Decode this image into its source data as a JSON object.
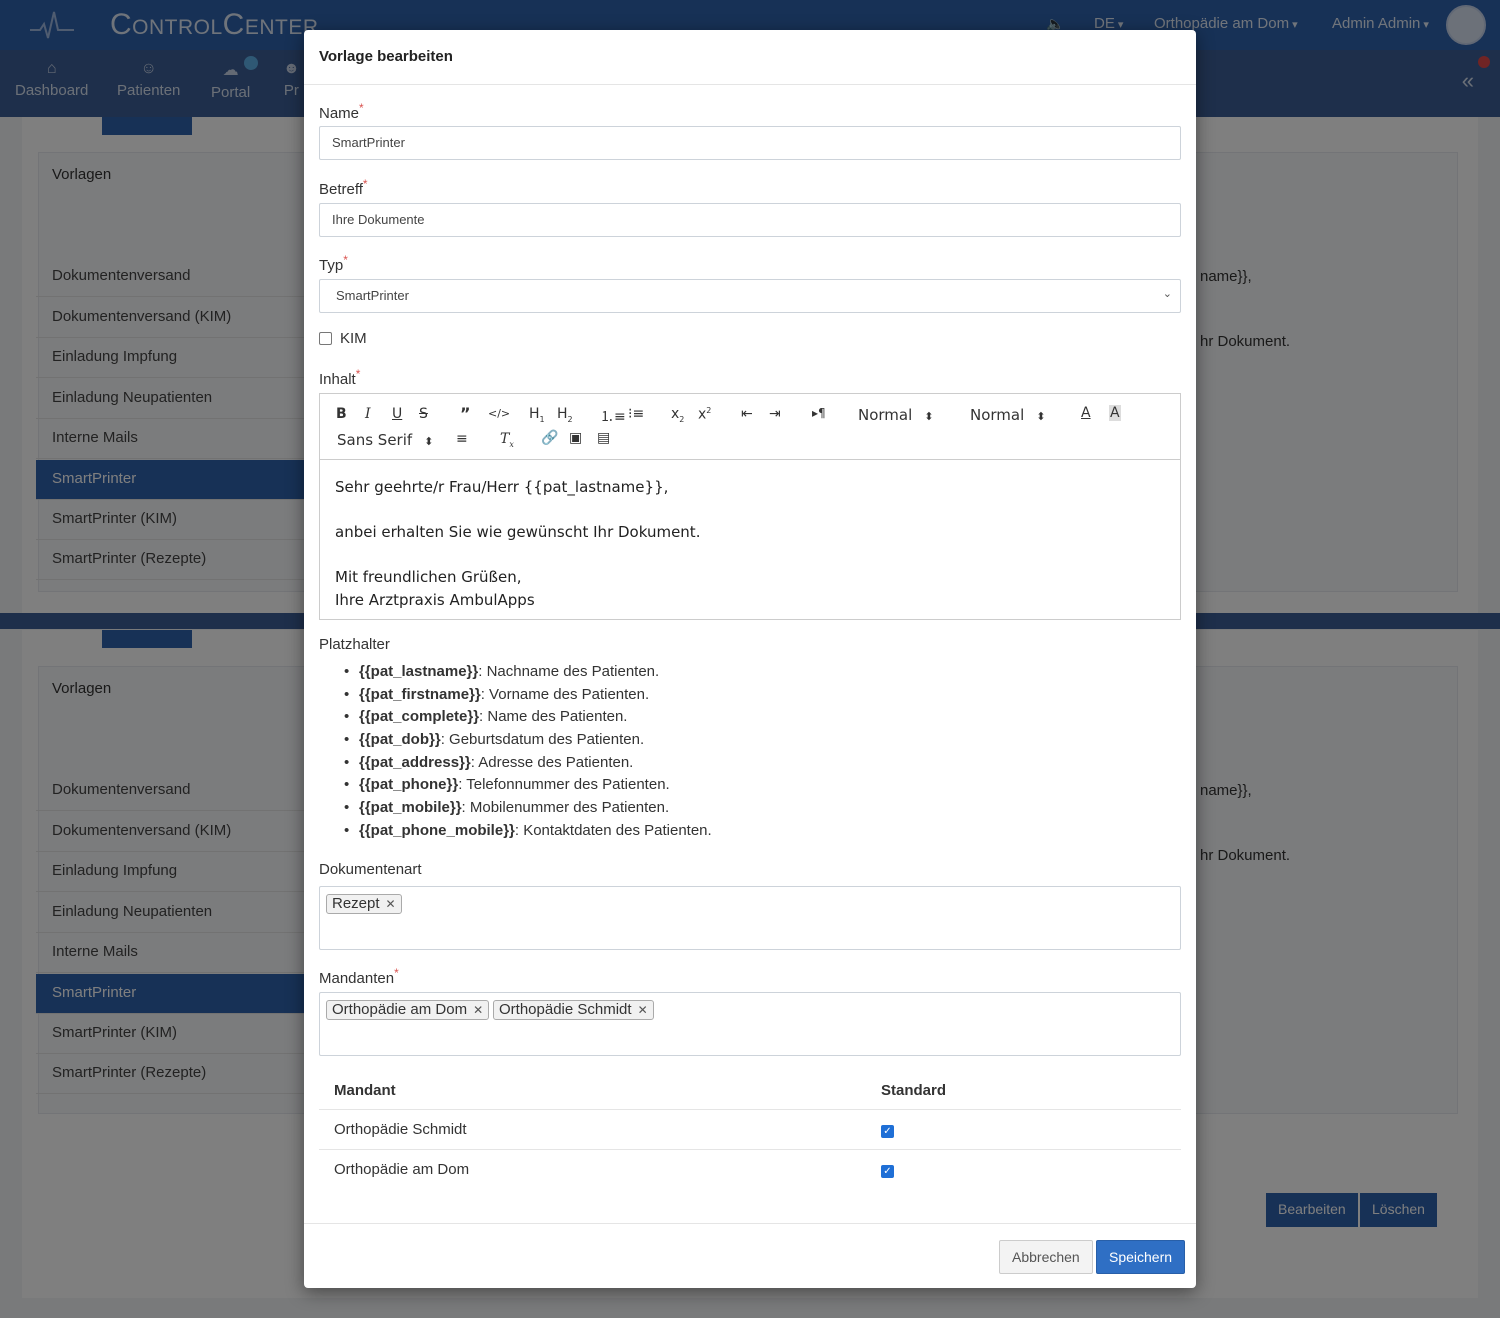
{
  "app": {
    "brand": "ControlCenter",
    "language": "DE",
    "practice": "Orthopädie am Dom",
    "user": "Admin Admin",
    "nav": [
      "Dashboard",
      "Patienten",
      "Portal",
      "Pr"
    ],
    "bg_card_title": "Vorlagen",
    "templates": [
      "Dokumentenversand",
      "Dokumentenversand (KIM)",
      "Einladung Impfung",
      "Einladung Neupatienten",
      "Interne Mails",
      "SmartPrinter",
      "SmartPrinter (KIM)",
      "SmartPrinter (Rezepte)"
    ],
    "bg_preview_1": "name}},",
    "bg_preview_2": "hr Dokument.",
    "btn_edit": "Bearbeiten",
    "btn_delete": "Löschen"
  },
  "modal": {
    "title": "Vorlage bearbeiten",
    "name_label": "Name",
    "name_value": "SmartPrinter",
    "subject_label": "Betreff",
    "subject_value": "Ihre Dokumente",
    "type_label": "Typ",
    "type_value": "SmartPrinter",
    "kim_label": "KIM",
    "content_label": "Inhalt",
    "toolbar": {
      "header_dropdown": "Normal",
      "size_dropdown": "Normal",
      "font_dropdown": "Sans Serif"
    },
    "content_lines": [
      "Sehr geehrte/r Frau/Herr {{pat_lastname}},",
      "",
      "anbei erhalten Sie wie gewünscht Ihr Dokument.",
      "",
      "Mit freundlichen Grüßen,",
      "Ihre Arztpraxis AmbulApps"
    ],
    "placeholders_title": "Platzhalter",
    "placeholders": [
      {
        "key": "{{pat_lastname}}",
        "desc": ": Nachname des Patienten."
      },
      {
        "key": "{{pat_firstname}}",
        "desc": ": Vorname des Patienten."
      },
      {
        "key": "{{pat_complete}}",
        "desc": ": Name des Patienten."
      },
      {
        "key": "{{pat_dob}}",
        "desc": ": Geburtsdatum des Patienten."
      },
      {
        "key": "{{pat_address}}",
        "desc": ": Adresse des Patienten."
      },
      {
        "key": "{{pat_phone}}",
        "desc": ": Telefonnummer des Patienten."
      },
      {
        "key": "{{pat_mobile}}",
        "desc": ": Mobilenummer des Patienten."
      },
      {
        "key": "{{pat_phone_mobile}}",
        "desc": ": Kontaktdaten des Patienten."
      }
    ],
    "doctype_label": "Dokumentenart",
    "doctype_tags": [
      "Rezept"
    ],
    "mandants_label": "Mandanten",
    "mandant_tags": [
      "Orthopädie am Dom",
      "Orthopädie Schmidt"
    ],
    "table": {
      "col_mandant": "Mandant",
      "col_standard": "Standard",
      "rows": [
        {
          "mandant": "Orthopädie Schmidt",
          "standard": true
        },
        {
          "mandant": "Orthopädie am Dom",
          "standard": true
        }
      ]
    },
    "cancel_label": "Abbrechen",
    "save_label": "Speichern"
  }
}
